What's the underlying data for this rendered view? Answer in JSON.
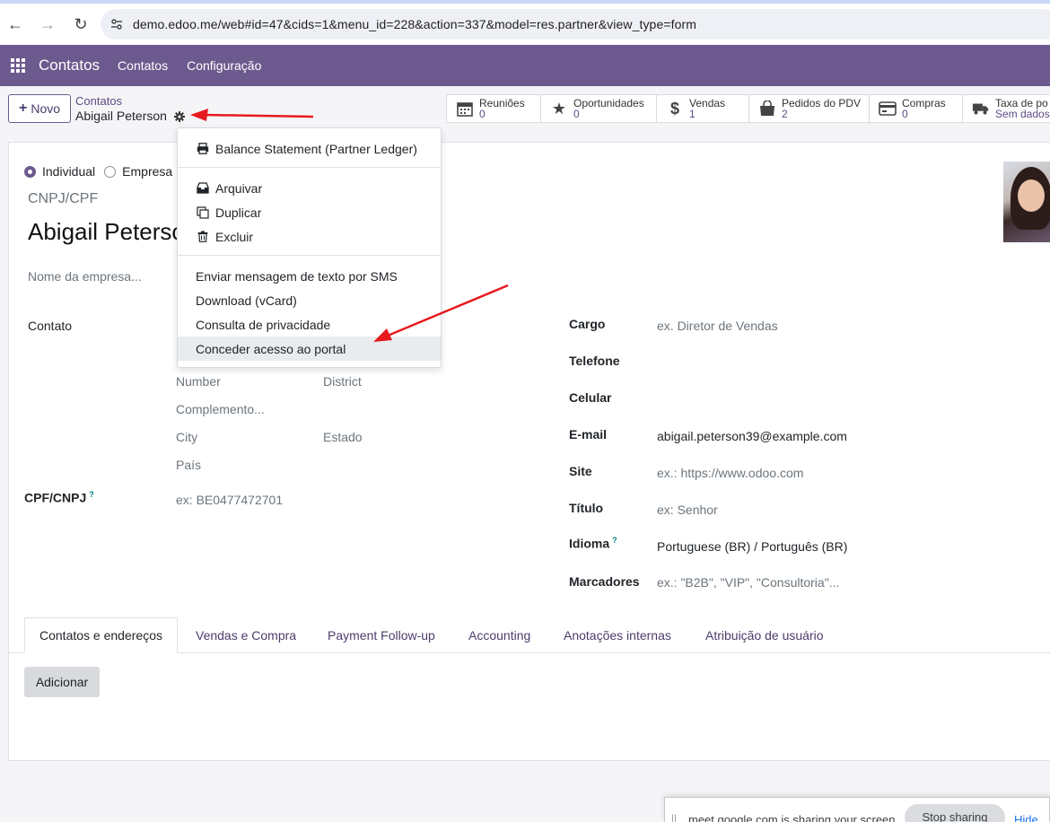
{
  "browser": {
    "url": "demo.edoo.me/web#id=47&cids=1&menu_id=228&action=337&model=res.partner&view_type=form"
  },
  "navbar": {
    "brand": "Contatos",
    "menu": [
      "Contatos",
      "Configuração"
    ]
  },
  "control": {
    "new_label": "Novo",
    "breadcrumb": "Contatos",
    "record_name": "Abigail Peterson"
  },
  "smart_buttons": [
    {
      "label": "Reuniões",
      "value": "0",
      "icon": "calendar-icon"
    },
    {
      "label": "Oportunidades",
      "value": "0",
      "icon": "star-icon"
    },
    {
      "label": "Vendas",
      "value": "1",
      "icon": "dollar-icon"
    },
    {
      "label": "Pedidos do PDV",
      "value": "2",
      "icon": "shopping-bag-icon"
    },
    {
      "label": "Compras",
      "value": "0",
      "icon": "credit-card-icon"
    },
    {
      "label": "Taxa de po",
      "value": "Sem dados",
      "icon": "truck-icon"
    }
  ],
  "form": {
    "type_individual": "Individual",
    "type_company": "Empresa",
    "cnpj_placeholder": "CNPJ/CPF",
    "name": "Abigail Peterson",
    "company_placeholder": "Nome da empresa...",
    "contato_label": "Contato",
    "address": {
      "number": "Number",
      "district": "District",
      "complement": "Complemento...",
      "city": "City",
      "state": "Estado",
      "country": "País"
    },
    "vat_label": "CPF/CNPJ",
    "vat_help": "?",
    "vat_placeholder": "ex: BE0477472701",
    "right": {
      "cargo_label": "Cargo",
      "cargo_ph": "ex. Diretor de Vendas",
      "telefone_label": "Telefone",
      "celular_label": "Celular",
      "email_label": "E-mail",
      "email_value": "abigail.peterson39@example.com",
      "site_label": "Site",
      "site_ph": "ex.: https://www.odoo.com",
      "titulo_label": "Título",
      "titulo_ph": "ex: Senhor",
      "idioma_label": "Idioma",
      "idioma_help": "?",
      "idioma_value": "Portuguese (BR) / Português (BR)",
      "marcadores_label": "Marcadores",
      "marcadores_ph": "ex.: \"B2B\", \"VIP\", \"Consultoria\"..."
    }
  },
  "tabs": [
    "Contatos e endereços",
    "Vendas e Compra",
    "Payment Follow-up",
    "Accounting",
    "Anotações internas",
    "Atribuição de usuário"
  ],
  "add_label": "Adicionar",
  "dropdown": {
    "balance": "Balance Statement (Partner Ledger)",
    "archive": "Arquivar",
    "duplicate": "Duplicar",
    "delete": "Excluir",
    "sms": "Enviar mensagem de texto por SMS",
    "vcard": "Download (vCard)",
    "privacy": "Consulta de privacidade",
    "portal": "Conceder acesso ao portal"
  },
  "share": {
    "text": "meet.google.com is sharing your screen.",
    "stop": "Stop sharing",
    "hide": "Hide"
  },
  "colors": {
    "navbar": "#6c5a8e",
    "accent": "#5d4a84",
    "annotation": "#e8191e"
  }
}
